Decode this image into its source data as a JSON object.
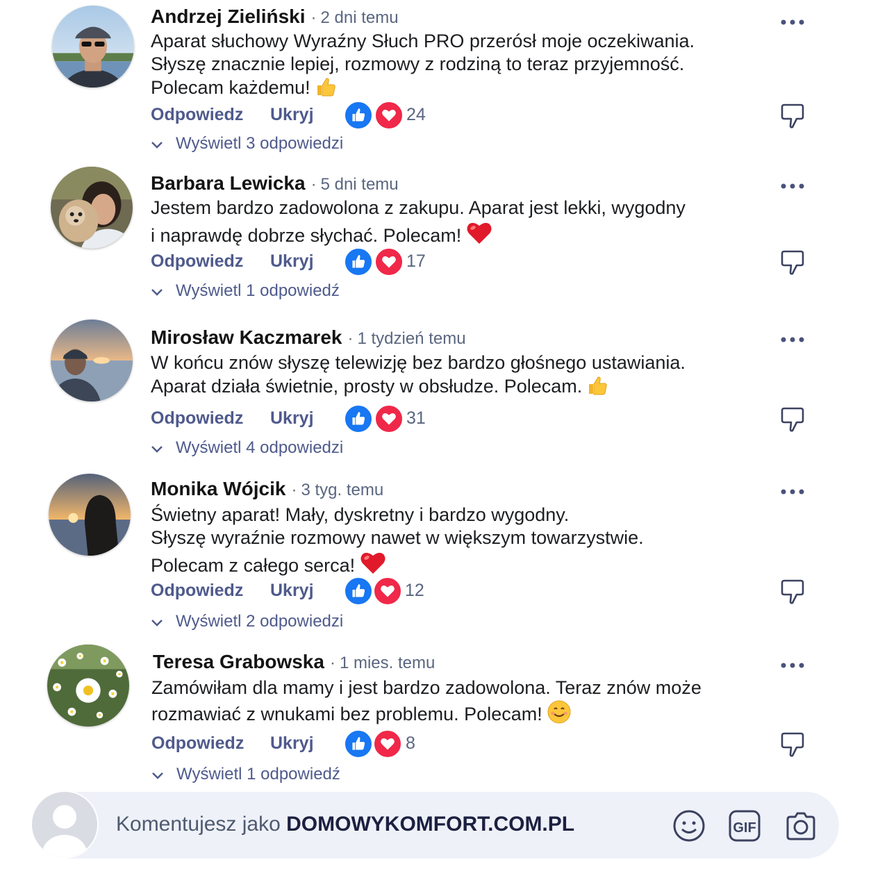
{
  "comments": [
    {
      "name": "Andrzej Zieliński",
      "time": "2 dni temu",
      "lines": [
        "Aparat słuchowy Wyraźny Słuch PRO przerósł moje oczekiwania.",
        "Słyszę znacznie lepiej, rozmowy z rodziną to teraz przyjemność.",
        "Polecam każdemu!"
      ],
      "emoji": "thumbs-up",
      "reply_label": "Odpowiedz",
      "hide_label": "Ukryj",
      "reaction_count": "24",
      "view_replies": "Wyświetl 3 odpowiedzi",
      "avatar": "man-with-cap-lake"
    },
    {
      "name": "Barbara Lewicka",
      "time": "5 dni temu",
      "lines": [
        "Jestem bardzo zadowolona z zakupu. Aparat jest lekki, wygodny",
        "i naprawdę dobrze słychać. Polecam!"
      ],
      "emoji": "heart",
      "reply_label": "Odpowiedz",
      "hide_label": "Ukryj",
      "reaction_count": "17",
      "view_replies": "Wyświetl 1 odpowiedź",
      "avatar": "woman-with-dog"
    },
    {
      "name": "Mirosław Kaczmarek",
      "time": "1 tydzień temu",
      "lines": [
        "W końcu znów słyszę telewizję bez bardzo głośnego ustawiania.",
        "Aparat działa świetnie, prosty w obsłudze. Polecam."
      ],
      "emoji": "thumbs-up",
      "reply_label": "Odpowiedz",
      "hide_label": "Ukryj",
      "reaction_count": "31",
      "view_replies": "Wyświetl 4 odpowiedzi",
      "avatar": "man-at-sunset-lake"
    },
    {
      "name": "Monika Wójcik",
      "time": "3 tyg. temu",
      "lines": [
        "Świetny aparat! Mały, dyskretny i bardzo wygodny.",
        "Słyszę wyraźnie rozmowy nawet w większym towarzystwie.",
        "Polecam z całego serca!"
      ],
      "emoji": "heart",
      "reply_label": "Odpowiedz",
      "hide_label": "Ukryj",
      "reaction_count": "12",
      "view_replies": "Wyświetl 2 odpowiedzi",
      "avatar": "woman-silhouette-sunset"
    },
    {
      "name": "Teresa Grabowska",
      "time": "1 mies. temu",
      "lines": [
        "Zamówiłam dla mamy i jest bardzo zadowolona. Teraz znów może",
        "rozmawiać z wnukami bez problemu. Polecam!"
      ],
      "emoji": "smile",
      "reply_label": "Odpowiedz",
      "hide_label": "Ukryj",
      "reaction_count": "8",
      "view_replies": "Wyświetl 1 odpowiedź",
      "avatar": "daisy-flowers"
    }
  ],
  "composer": {
    "prefix": "Komentujesz jako ",
    "account": "DOMOWYKOMFORT.COM.PL",
    "icons": [
      "emoji-icon",
      "gif-icon",
      "camera-icon"
    ],
    "gif_label": "GIF"
  },
  "colors": {
    "like_blue": "#1877f2",
    "heart_red": "#f02849",
    "action_text": "#4f5a8c",
    "composer_bg": "#eef1f8"
  }
}
